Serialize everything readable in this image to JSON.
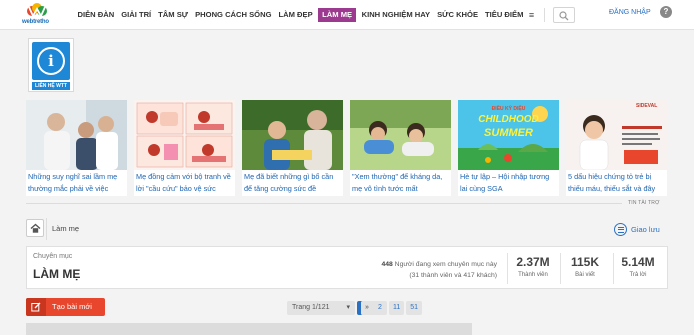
{
  "site": {
    "logo_text": "webtretho"
  },
  "nav": {
    "items": [
      "DIỄN ĐÀN",
      "GIẢI TRÍ",
      "TÂM SỰ",
      "PHONG CÁCH SỐNG",
      "LÀM ĐẸP",
      "LÀM MẸ",
      "KINH NGHIỆM HAY",
      "SỨC KHỎE",
      "TIÊU ĐIỂM"
    ],
    "active": "LÀM MẸ",
    "menu_icon": "hamburger-icon",
    "login_label": "ĐĂNG NHẬP",
    "help_symbol": "?"
  },
  "badge": {
    "label": "LIÊN HỆ WTT",
    "symbol": "i"
  },
  "articles": [
    {
      "title": "Những suy nghĩ sai lầm mẹ thường mắc phải về việc"
    },
    {
      "title": "Mẹ đồng cảm với bộ tranh về lời \"cầu cứu\" bảo vệ sức"
    },
    {
      "title": "Mẹ đã biết những gì bổ cần để tăng cường sức đề"
    },
    {
      "title": "\"Xem thường\" để kháng da, mẹ vô tình tước mất"
    },
    {
      "title": "Hè tự lập – Hội nhập tương lai cùng SGA"
    },
    {
      "title": "5 dấu hiệu chứng tỏ trẻ bị thiếu máu, thiếu sắt và đây"
    }
  ],
  "article_image_texts": {
    "card5_heading": "CHILDHOOD",
    "card5_sub": "SUMMER",
    "card5_top": "ĐIỀU KỲ DIỆU",
    "card6_brand": "SIDEVAL"
  },
  "sponsor_label": "TIN TÀI TRỢ",
  "breadcrumb": {
    "current": "Làm mẹ"
  },
  "guide_label": "Giao lưu",
  "category": {
    "subtitle": "Chuyên mục",
    "title": "LÀM MẸ",
    "viewers_count": "448",
    "viewers_text": " Người đang xem chuyên mục này",
    "viewers_detail": "(31 thành viên và 417 khách)",
    "stats": [
      {
        "value": "2.37M",
        "label": "Thành viên"
      },
      {
        "value": "115K",
        "label": "Bài viết"
      },
      {
        "value": "5.14M",
        "label": "Trả lời"
      }
    ]
  },
  "new_post_label": "Tạo bài mới",
  "pagination": {
    "select_label": "Trang 1/121",
    "pages": [
      "1",
      "2",
      "11",
      "51"
    ],
    "current": "1",
    "next": "»",
    "last": "»"
  },
  "colors": {
    "accent": "#9b3a8e",
    "link": "#2a71c4",
    "new_post": "#e8472d",
    "info": "#1e88d6"
  }
}
